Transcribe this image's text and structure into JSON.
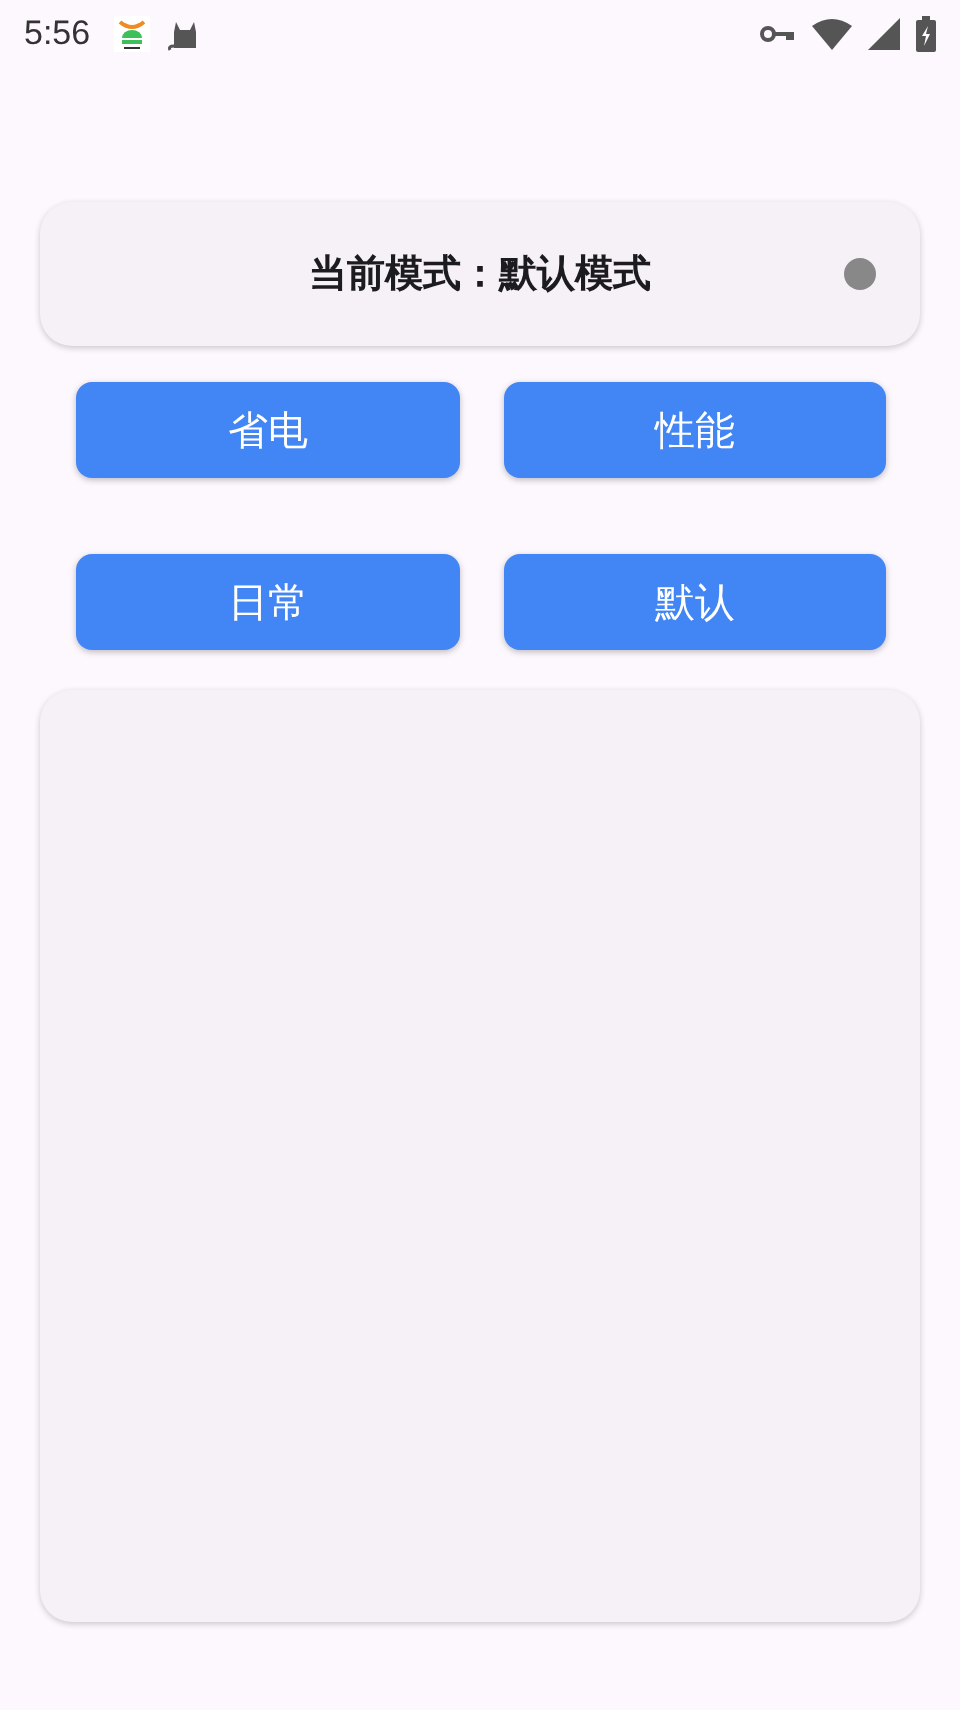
{
  "status_bar": {
    "time": "5:56"
  },
  "mode_card": {
    "text": "当前模式：默认模式"
  },
  "buttons": [
    {
      "label": "省电"
    },
    {
      "label": "性能"
    },
    {
      "label": "日常"
    },
    {
      "label": "默认"
    }
  ]
}
